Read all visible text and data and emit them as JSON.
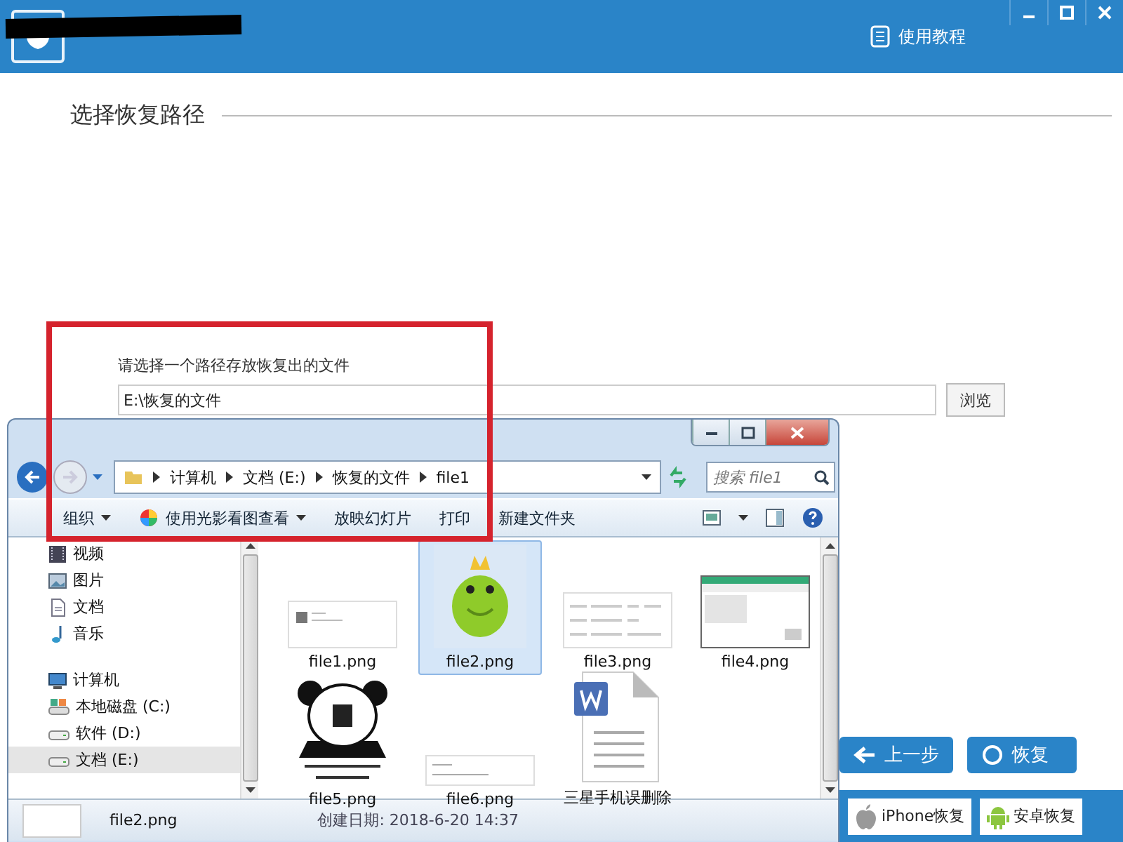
{
  "app": {
    "help_link": "使用教程",
    "section_title": "选择恢复路径",
    "path_label": "请选择一个路径存放恢复出的文件",
    "path_value": "E:\\恢复的文件",
    "browse_button": "浏览",
    "actions": [
      {
        "label": "上一步",
        "kind": "back"
      },
      {
        "label": "恢复",
        "kind": "next"
      }
    ],
    "bottom_buttons": [
      {
        "label": "iPhone恢复",
        "kind": "apple"
      },
      {
        "label": "安卓恢复",
        "kind": "android"
      }
    ]
  },
  "explorer": {
    "breadcrumb": [
      "计算机",
      "文档 (E:)",
      "恢复的文件",
      "file1"
    ],
    "search_placeholder": "搜索 file1",
    "toolbar": [
      {
        "label": "组织",
        "kind": "menu"
      },
      {
        "label": "使用光影看图查看",
        "kind": "app-menu"
      },
      {
        "label": "放映幻灯片",
        "kind": "plain"
      },
      {
        "label": "打印",
        "kind": "plain"
      },
      {
        "label": "新建文件夹",
        "kind": "plain"
      }
    ],
    "sidebar": [
      {
        "label": "视频",
        "kind": "video",
        "selected": false
      },
      {
        "label": "图片",
        "kind": "picture",
        "selected": false
      },
      {
        "label": "文档",
        "kind": "document",
        "selected": false
      },
      {
        "label": "音乐",
        "kind": "music",
        "selected": false
      },
      {
        "label": "计算机",
        "kind": "computer",
        "selected": false,
        "children": [
          {
            "label": "本地磁盘 (C:)",
            "kind": "system-drive",
            "selected": false
          },
          {
            "label": "软件 (D:)",
            "kind": "drive",
            "selected": false
          },
          {
            "label": "文档 (E:)",
            "kind": "drive",
            "selected": true
          }
        ]
      }
    ],
    "files": [
      {
        "name": "file1.png",
        "kind": "screenshot",
        "selected": false
      },
      {
        "name": "file2.png",
        "kind": "sticker",
        "selected": true
      },
      {
        "name": "file3.png",
        "kind": "form",
        "selected": false
      },
      {
        "name": "file4.png",
        "kind": "app-window",
        "selected": false
      },
      {
        "name": "file5.png",
        "kind": "panda",
        "selected": false
      },
      {
        "name": "file6.png",
        "kind": "note",
        "selected": false
      },
      {
        "name": "三星手机误删除",
        "kind": "document",
        "selected": false
      }
    ],
    "status": {
      "file_name": "file2.png",
      "created": "创建日期: 2018-6-20 14:37"
    }
  }
}
